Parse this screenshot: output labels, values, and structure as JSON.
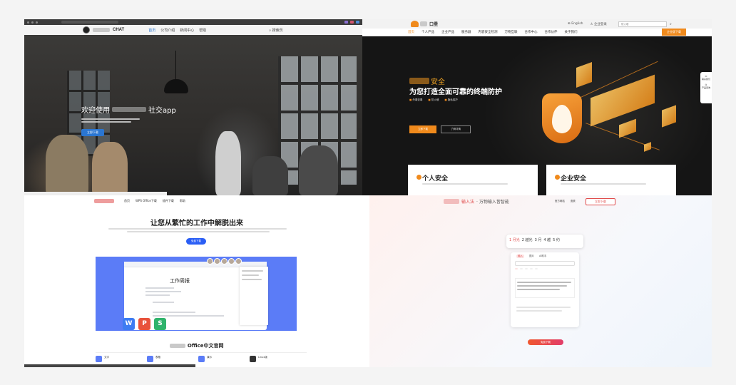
{
  "chat_site": {
    "brand": "CHAT",
    "nav_links": [
      "首页",
      "公司介绍",
      "新闻中心",
      "帮助"
    ],
    "search_label": "搜索页",
    "hero_title_prefix": "欢迎使用",
    "hero_title_suffix": "社交app",
    "hero_button": "立即下载"
  },
  "security_site": {
    "logo_text": "口堡",
    "top_links": [
      "English",
      "企业登录"
    ],
    "search_placeholder": "防火墙",
    "nav_items": [
      "首页",
      "个人产品",
      "企业产品",
      "服务器",
      "内容安全检测",
      "万物互联",
      "合作中心",
      "合作伙伴",
      "关于我们"
    ],
    "nav_button": "企业版下载",
    "hero_brand_suffix": "安全",
    "hero_title": "为您打造全面可靠的终端防护",
    "hero_bullets": [
      "杀毒查毒",
      "防火墙",
      "隐私保护"
    ],
    "hero_btn_primary": "立即下载",
    "hero_btn_secondary": "了解详情",
    "side_float": [
      "联系我们",
      "产品咨询"
    ],
    "cards": [
      {
        "title": "个人安全"
      },
      {
        "title": "企业安全"
      }
    ]
  },
  "office_site": {
    "nav_links": [
      "首页",
      "WPS Office下载",
      "插件下载",
      "帮助"
    ],
    "title": "让您从繁忙的工作中解脱出来",
    "cta": "免费下载",
    "doc_title": "工作周报",
    "app_tiles": [
      "W",
      "P",
      "S"
    ],
    "section_title": "Office中文官网",
    "features": [
      "文字",
      "表格",
      "演示",
      "Linux版"
    ]
  },
  "ime_site": {
    "brand": "输入法",
    "slogan": "万物输入皆智能",
    "nav_links": [
      "官方网站",
      "皮肤"
    ],
    "download_button": "立即下载",
    "candidates": [
      "1 月光",
      "2 越光",
      "3 月",
      "4 越",
      "5 约"
    ],
    "panel_tabs": [
      "输入",
      "图片",
      "AI助手"
    ],
    "cta": "免费下载"
  }
}
